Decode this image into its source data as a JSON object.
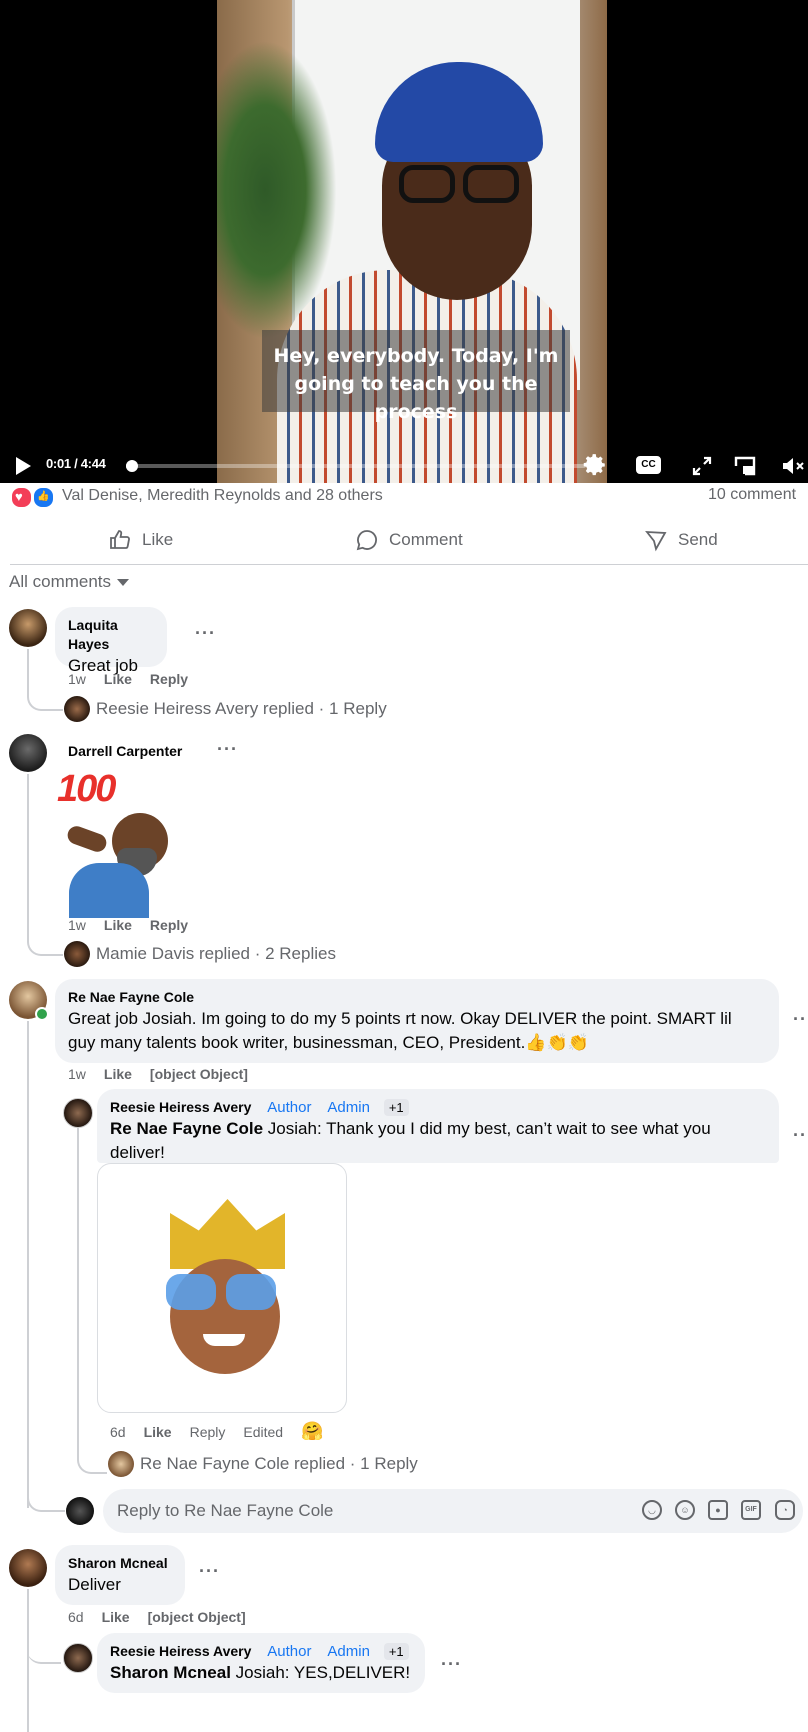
{
  "video": {
    "caption_line1": "Hey, everybody. Today, I'm",
    "caption_line2": "going to teach you the process",
    "time": "0:01 / 4:44",
    "progress_fraction": 0.0036,
    "cc_label": "CC"
  },
  "reactions": {
    "names": "Val Denise, Meredith Reynolds and 28 others",
    "comment_count": "10 comment"
  },
  "actions": {
    "like": "Like",
    "comment": "Comment",
    "send": "Send"
  },
  "filter": {
    "label": "All comments"
  },
  "comments": [
    {
      "author": "Laquita Hayes",
      "text": "Great job",
      "time": "1w",
      "like": "Like",
      "reply": "Reply",
      "replies_summary": "Reesie Heiress Avery replied · 1 Reply"
    },
    {
      "author": "Darrell Carpenter",
      "sticker_text": "100",
      "time": "1w",
      "like": "Like",
      "reply": "Reply",
      "replies_summary": "Mamie Davis replied · 2 Replies"
    },
    {
      "author": "Re Nae Fayne Cole",
      "text_line1": "Great job Josiah. Im going to do my 5 points rt now. Okay DELIVER the point. SMART lil",
      "text_line2": "guy many talents book writer, businessman, CEO, President.👍👏👏",
      "time": "1w",
      "like": "Like",
      "reply": {
        "author": "Reesie Heiress Avery",
        "badge_author": "Author",
        "badge_admin": "Admin",
        "badge_plus": "+1",
        "mention": "Re Nae Fayne Cole",
        "text_line1": "Josiah: Thank you I did my best, can’t wait to see what you",
        "text_line2": "deliver!",
        "time": "6d",
        "like": "Like",
        "reply": "Reply",
        "edited": "Edited",
        "replies_summary": "Re Nae Fayne Cole replied · 1 Reply"
      },
      "reply_placeholder": "Reply to Re Nae Fayne Cole"
    },
    {
      "author": "Sharon Mcneal",
      "text": "Deliver",
      "time": "6d",
      "like": "Like",
      "reply": {
        "author": "Reesie Heiress Avery",
        "badge_author": "Author",
        "badge_admin": "Admin",
        "badge_plus": "+1",
        "mention": "Sharon Mcneal",
        "text": "Josiah: YES,DELIVER!"
      }
    }
  ],
  "icons": {
    "composer": [
      "avatar-sticker-icon",
      "emoji-icon",
      "camera-icon",
      "gif-icon",
      "sticker-icon"
    ]
  },
  "colors": {
    "accent": "#1877f2",
    "bubble": "#f0f2f5",
    "meta": "#65676b",
    "online": "#31a24c"
  }
}
